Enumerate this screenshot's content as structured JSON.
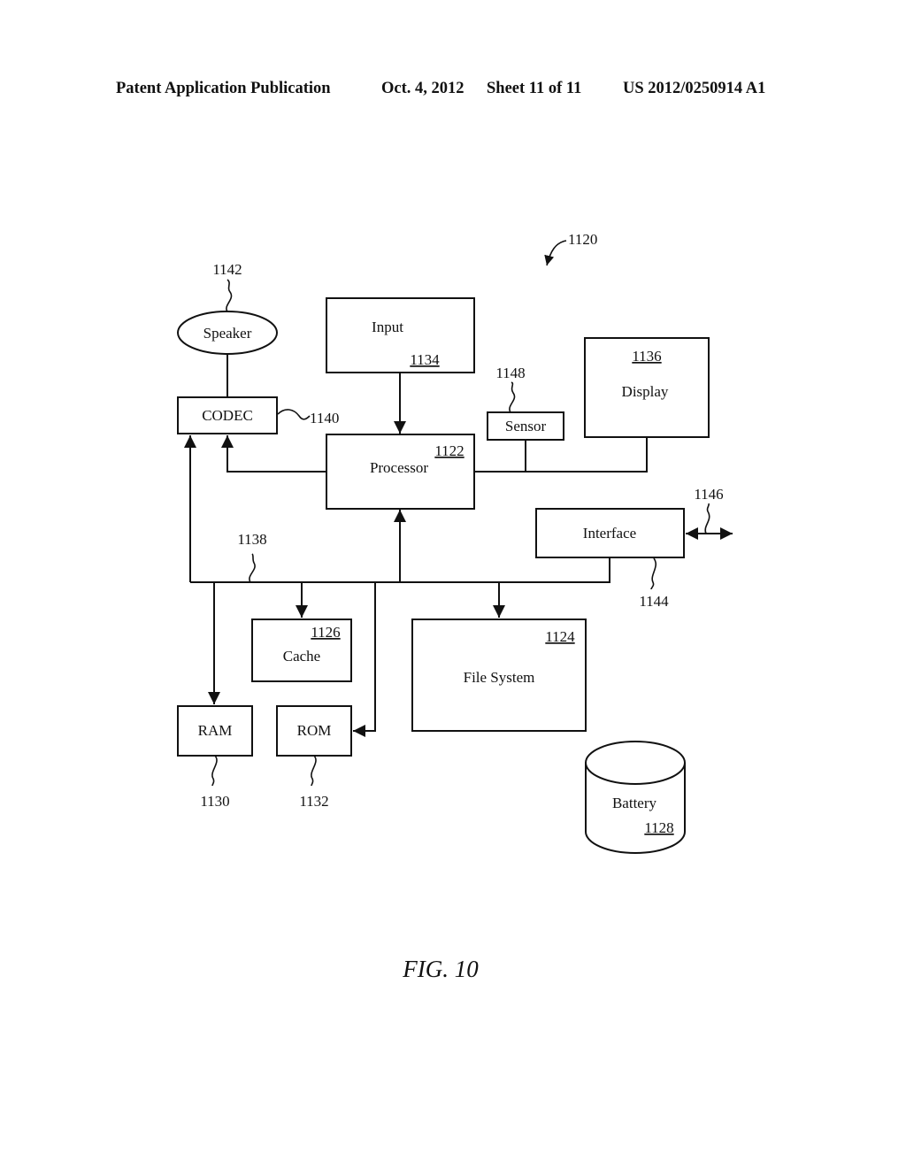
{
  "header": {
    "publication": "Patent Application Publication",
    "date": "Oct. 4, 2012",
    "sheet": "Sheet 11 of 11",
    "number": "US 2012/0250914 A1"
  },
  "diagram": {
    "ref": "1120",
    "components": {
      "speaker": {
        "label": "Speaker",
        "ref": "1142"
      },
      "codec": {
        "label": "CODEC",
        "ref": "1140"
      },
      "input": {
        "label": "Input",
        "ref": "1134"
      },
      "processor": {
        "label": "Processor",
        "ref": "1122"
      },
      "sensor": {
        "label": "Sensor",
        "ref": "1148"
      },
      "display": {
        "label": "Display",
        "ref": "1136"
      },
      "interface": {
        "label": "Interface",
        "ref": "1144"
      },
      "io_link": {
        "ref": "1146"
      },
      "bus": {
        "ref": "1138"
      },
      "cache": {
        "label": "Cache",
        "ref": "1126"
      },
      "file_system": {
        "label": "File System",
        "ref": "1124"
      },
      "ram": {
        "label": "RAM",
        "ref": "1130"
      },
      "rom": {
        "label": "ROM",
        "ref": "1132"
      },
      "battery": {
        "label": "Battery",
        "ref": "1128"
      }
    }
  },
  "figure_label": "FIG. 10"
}
